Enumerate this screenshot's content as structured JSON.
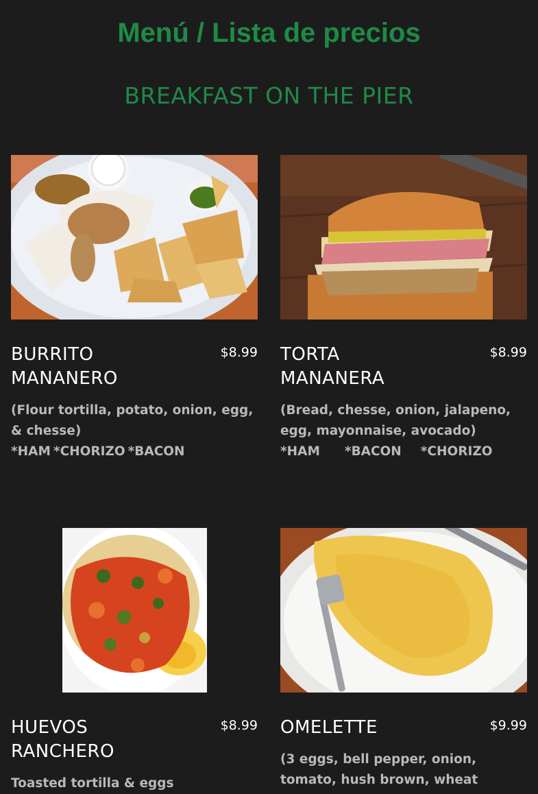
{
  "header": {
    "title": "Menú / Lista de precios",
    "subtitle": "BREAKFAST ON THE PIER"
  },
  "colors": {
    "background": "#1c1c1d",
    "accent": "#1f8a46",
    "description": "#b9b9b9"
  },
  "items": [
    {
      "name_line1": "BURRITO",
      "name_line2": "MANANERO",
      "price": "$8.99",
      "desc_line1": "(Flour tortilla, potato, onion, egg,",
      "desc_line2": "& chesse)",
      "options": [
        "*HAM",
        "*CHORIZO",
        "*BACON"
      ],
      "image": "burrito-plate-photo"
    },
    {
      "name_line1": "TORTA",
      "name_line2": "MANANERA",
      "price": "$8.99",
      "desc_line1": "(Bread, chesse, onion, jalapeno,",
      "desc_line2": "egg, mayonnaise, avocado)",
      "options": [
        "*HAM",
        "*BACON",
        "*CHORIZO"
      ],
      "image": "torta-sandwich-photo"
    },
    {
      "name_line1": "HUEVOS",
      "name_line2": "RANCHERO",
      "price": "$8.99",
      "desc_line1": "Toasted tortilla & eggs",
      "image": "huevos-rancheros-photo"
    },
    {
      "name_line1": "OMELETTE",
      "price": "$9.99",
      "desc_line1": "(3 eggs, bell pepper, onion,",
      "desc_line2": "tomato, hush brown, wheat",
      "image": "omelette-plate-photo"
    }
  ]
}
